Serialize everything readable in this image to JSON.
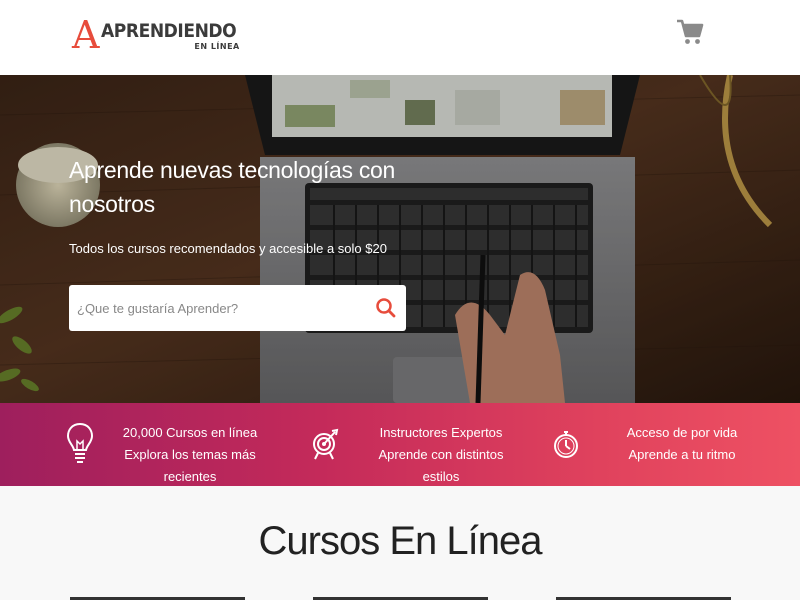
{
  "header": {
    "logo_letter": "A",
    "logo_title": "APRENDIENDO",
    "logo_subtitle": "EN LÍNEA",
    "cart_icon": "shopping-cart-icon"
  },
  "hero": {
    "title": "Aprende nuevas tecnologías con nosotros",
    "subtitle": "Todos los cursos recomendados y accesible a solo $20",
    "search": {
      "placeholder": "¿Que te gustaría Aprender?",
      "value": "",
      "button_icon": "search-icon"
    }
  },
  "features": [
    {
      "icon": "lightbulb-icon",
      "line1": "20,000 Cursos en línea",
      "line2": "Explora los temas más recientes"
    },
    {
      "icon": "target-icon",
      "line1": "Instructores Expertos",
      "line2": "Aprende con distintos estilos"
    },
    {
      "icon": "clock-icon",
      "line1": "Acceso de por vida",
      "line2": "Aprende a tu ritmo"
    }
  ],
  "section": {
    "title": "Cursos En Línea"
  },
  "colors": {
    "accent": "#e74c3c",
    "bar_start": "#9e1f5d",
    "bar_end": "#ee5163",
    "cart_gray": "#888888"
  }
}
